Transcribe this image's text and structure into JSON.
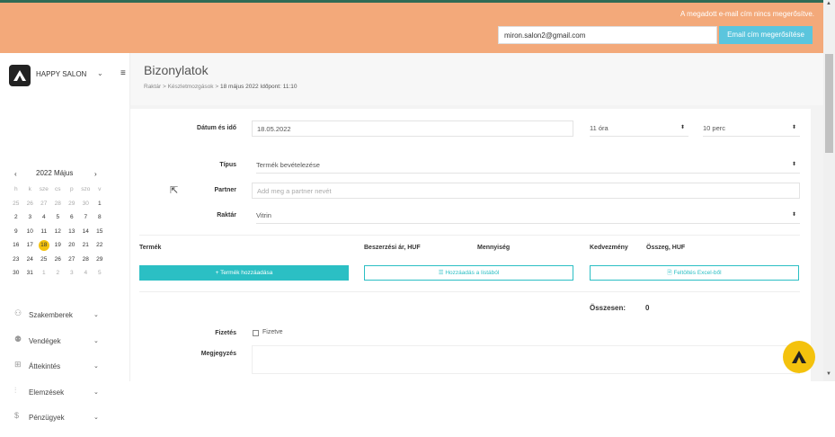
{
  "banner": {
    "message": "A megadott e-mail cím nincs megerősítve.",
    "email_value": "miron.salon2@gmail.com",
    "confirm_label": "Email cím megerősítése"
  },
  "sidebar": {
    "salon_name": "HAPPY SALON",
    "calendar": {
      "title": "2022 Május",
      "prev": "‹",
      "next": "›",
      "day_names": [
        "h",
        "k",
        "sze",
        "cs",
        "p",
        "szo",
        "v"
      ],
      "weeks": [
        [
          "25",
          "26",
          "27",
          "28",
          "29",
          "30",
          "1"
        ],
        [
          "2",
          "3",
          "4",
          "5",
          "6",
          "7",
          "8"
        ],
        [
          "9",
          "10",
          "11",
          "12",
          "13",
          "14",
          "15"
        ],
        [
          "16",
          "17",
          "18",
          "19",
          "20",
          "21",
          "22"
        ],
        [
          "23",
          "24",
          "25",
          "26",
          "27",
          "28",
          "29"
        ],
        [
          "30",
          "31",
          "1",
          "2",
          "3",
          "4",
          "5"
        ]
      ],
      "today": "18"
    },
    "menu": [
      {
        "label": "Szakemberek",
        "icon": "person-icon"
      },
      {
        "label": "Vendégek",
        "icon": "group-icon"
      },
      {
        "label": "Áttekintés",
        "icon": "grid-icon"
      },
      {
        "label": "Elemzések",
        "icon": "chart-icon"
      },
      {
        "label": "Pénzügyek",
        "icon": "money-icon"
      }
    ]
  },
  "header": {
    "title": "Bizonylatok",
    "breadcrumb": {
      "items": [
        "Raktár",
        "Készletmozgások"
      ],
      "separator": ">",
      "current": "18 május 2022 Időpont: 11:10"
    }
  },
  "form": {
    "date_label": "Dátum és idő",
    "date_value": "18.05.2022",
    "hour_value": "11 óra",
    "minute_value": "10 perc",
    "type_label": "Típus",
    "type_value": "Termék bevételezése",
    "partner_label": "Partner",
    "partner_placeholder": "Add meg a partner nevét",
    "warehouse_label": "Raktár",
    "warehouse_value": "Vitrin",
    "columns": {
      "product": "Termék",
      "purchase_price": "Beszerzési ár, HUF",
      "quantity": "Mennyiség",
      "discount": "Kedvezmény",
      "amount": "Összeg, HUF"
    },
    "add_product_label": "+ Termék hozzáadása",
    "add_from_list_label": "☰ Hozzáadás a listából",
    "upload_excel_label": "🗎 Feltöltés Excel-ből",
    "total_label": "Összesen:",
    "total_value": "0",
    "payment_label": "Fizetés",
    "paid_label": "Fizetve",
    "note_label": "Megjegyzés"
  },
  "colors": {
    "banner": "#f3a97a",
    "accent": "#2bbfc4",
    "confirm_button": "#5bc5dd",
    "today_highlight": "#f4c20d"
  }
}
